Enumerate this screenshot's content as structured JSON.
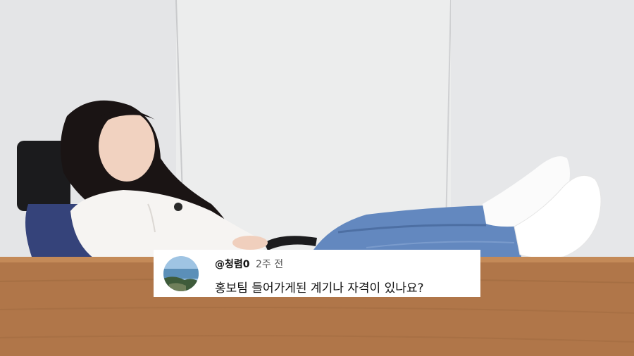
{
  "comment": {
    "author": "@청렴0",
    "time": "2주 전",
    "text": "홍보팀 들어가게된 계기나 자격이 있나요?",
    "avatar_icon": "seaside-photo-avatar"
  },
  "colors": {
    "wall": "#e9eaec",
    "desk": "#b57b4d",
    "jeans": "#5a7fb5",
    "card": "#ffffff"
  }
}
